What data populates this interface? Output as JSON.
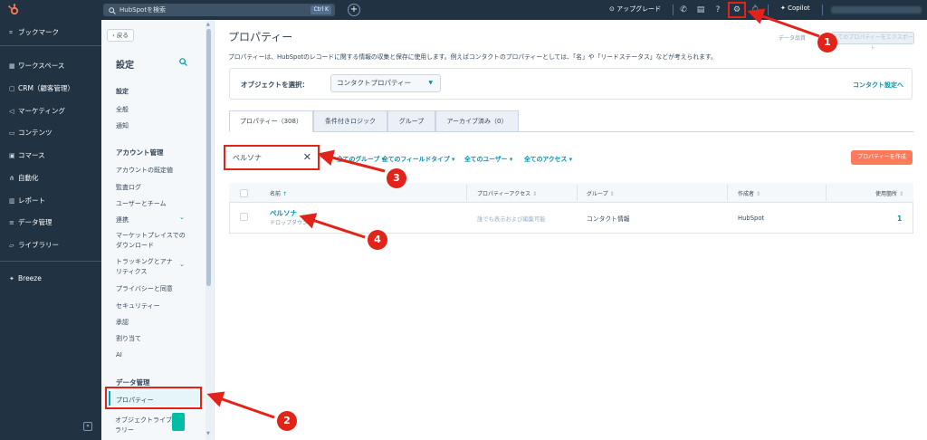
{
  "topbar": {
    "search_placeholder": "HubSpotを検索",
    "search_shortcut": "Ctrl K",
    "plus": "+",
    "upgrade": "アップグレード",
    "copilot": "Copilot",
    "icons": [
      "hubspot-logo",
      "search-icon",
      "plus-icon",
      "upgrade-icon",
      "phone-icon",
      "marketplace-icon",
      "help-icon",
      "gear-icon",
      "bell-icon",
      "copilot-icon"
    ]
  },
  "leftnav": {
    "items": [
      {
        "label": "ブックマーク",
        "icon": "bookmark-icon"
      },
      {
        "label": "ワークスペース",
        "icon": "workspace-icon"
      },
      {
        "label": "CRM（顧客管理）",
        "icon": "crm-icon"
      },
      {
        "label": "マーケティング",
        "icon": "marketing-icon"
      },
      {
        "label": "コンテンツ",
        "icon": "content-icon"
      },
      {
        "label": "コマース",
        "icon": "commerce-icon"
      },
      {
        "label": "自動化",
        "icon": "automation-icon"
      },
      {
        "label": "レポート",
        "icon": "report-icon"
      },
      {
        "label": "データ管理",
        "icon": "data-icon"
      },
      {
        "label": "ライブラリー",
        "icon": "library-icon"
      },
      {
        "label": "Breeze",
        "icon": "breeze-icon"
      }
    ],
    "collapse": "«"
  },
  "settings": {
    "back": "戻る",
    "title": "設定",
    "sections": {
      "settings_head": "設定",
      "general": "全般",
      "notifications": "通知",
      "account_head": "アカウント管理",
      "account_defaults": "アカウントの既定値",
      "audit_log": "監査ログ",
      "users_teams": "ユーザーとチーム",
      "integrations": "連携",
      "marketplace_1": "マーケットプレイスでの",
      "marketplace_2": "ダウンロード",
      "tracking_1": "トラッキングとアナ",
      "tracking_2": "リティクス",
      "privacy": "プライバシーと同意",
      "security": "セキュリティー",
      "approvals": "承認",
      "assignments": "割り当て",
      "ai": "AI",
      "data_head": "データ管理",
      "properties": "プロパティー",
      "object_lib_1": "オブジェクトライブ",
      "object_lib_2": "ラリー"
    }
  },
  "main": {
    "title": "プロパティー",
    "description": "プロパティーは、HubSpotのレコードに関する情報の収集と保存に使用します。例えばコンタクトのプロパティーとしては、「名」や「リードステータス」などが考えられます。",
    "data_quality": "データ品質",
    "export_button": "全てのプロパティーをエクスポート",
    "object_label": "オブジェクトを選択：",
    "object_value": "コンタクトプロパティー",
    "contact_settings": "コンタクト設定へ",
    "tabs": [
      "プロパティー（308）",
      "条件付きロジック",
      "グループ",
      "アーカイブ済み（0）"
    ],
    "search_value": "ペルソナ",
    "filters": [
      "全てのグループ",
      "全てのフィールドタイプ",
      "全てのユーザー",
      "全てのアクセス"
    ],
    "create_button": "プロパティーを作成",
    "table": {
      "headers": [
        "名前",
        "プロパティーアクセス",
        "グループ",
        "作成者",
        "使用箇所"
      ],
      "rows": [
        {
          "name": "ペルソナ",
          "type": "ドロップダウン",
          "access": "誰でも表示および編集可能",
          "group": "コンタクト情報",
          "creator": "HubSpot",
          "usage": "1"
        }
      ]
    }
  },
  "annotations": [
    "1",
    "2",
    "3",
    "4"
  ],
  "colors": {
    "nav_bg": "#213343",
    "accent": "#0091ae",
    "primary_button": "#ff7a59",
    "annotation_red": "#e2231a"
  }
}
